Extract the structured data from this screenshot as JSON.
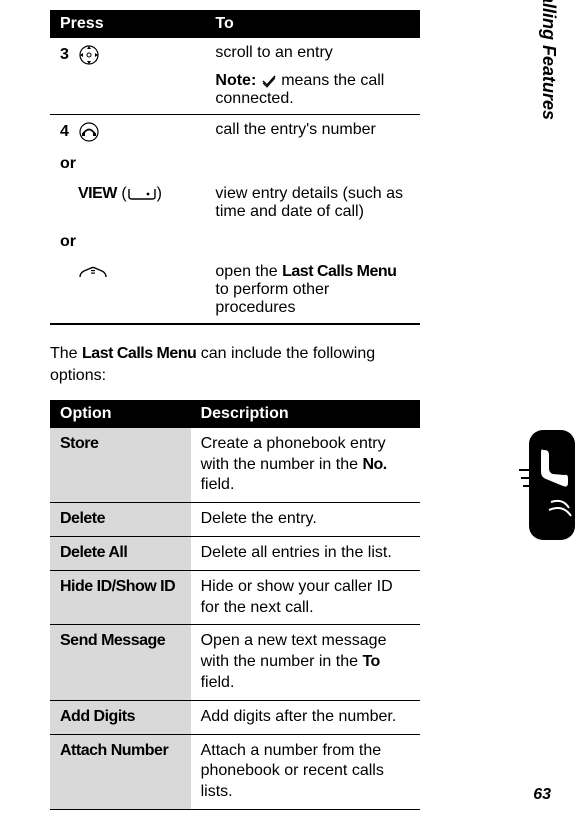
{
  "press_header": {
    "col1": "Press",
    "col2": "To"
  },
  "steps": {
    "s3": {
      "num": "3",
      "action": "scroll to an entry",
      "note_label": "Note:",
      "note_text": " means the call connected."
    },
    "s4": {
      "num": "4",
      "action1": "call the entry's number",
      "or": "or",
      "view_label": "VIEW",
      "view_paren_open": " (",
      "view_paren_close": ")",
      "action2": "view entry details (such as time and date of call)",
      "action3_a": "open the ",
      "action3_menu": "Last Calls Menu",
      "action3_b": " to perform other procedures"
    }
  },
  "intro_a": "The ",
  "intro_menu": "Last Calls Menu",
  "intro_b": " can include the following options:",
  "option_header": {
    "col1": "Option",
    "col2": "Description"
  },
  "options": [
    {
      "name": "Store",
      "desc_a": "Create a phonebook entry with the number in the ",
      "desc_kw": "No.",
      "desc_b": " field."
    },
    {
      "name": "Delete",
      "desc_a": "Delete the entry.",
      "desc_kw": "",
      "desc_b": ""
    },
    {
      "name": "Delete All",
      "desc_a": "Delete all entries in the list.",
      "desc_kw": "",
      "desc_b": ""
    },
    {
      "name": "Hide ID/Show ID",
      "desc_a": "Hide or show your caller ID for the next call.",
      "desc_kw": "",
      "desc_b": ""
    },
    {
      "name": "Send Message",
      "desc_a": "Open a new text message with the number in the ",
      "desc_kw": "To",
      "desc_b": " field."
    },
    {
      "name": "Add Digits",
      "desc_a": "Add digits after the number.",
      "desc_kw": "",
      "desc_b": ""
    },
    {
      "name": "Attach Number",
      "desc_a": "Attach a number from the phonebook or recent calls lists.",
      "desc_kw": "",
      "desc_b": ""
    }
  ],
  "side_label": "Calling Features",
  "page_number": "63"
}
